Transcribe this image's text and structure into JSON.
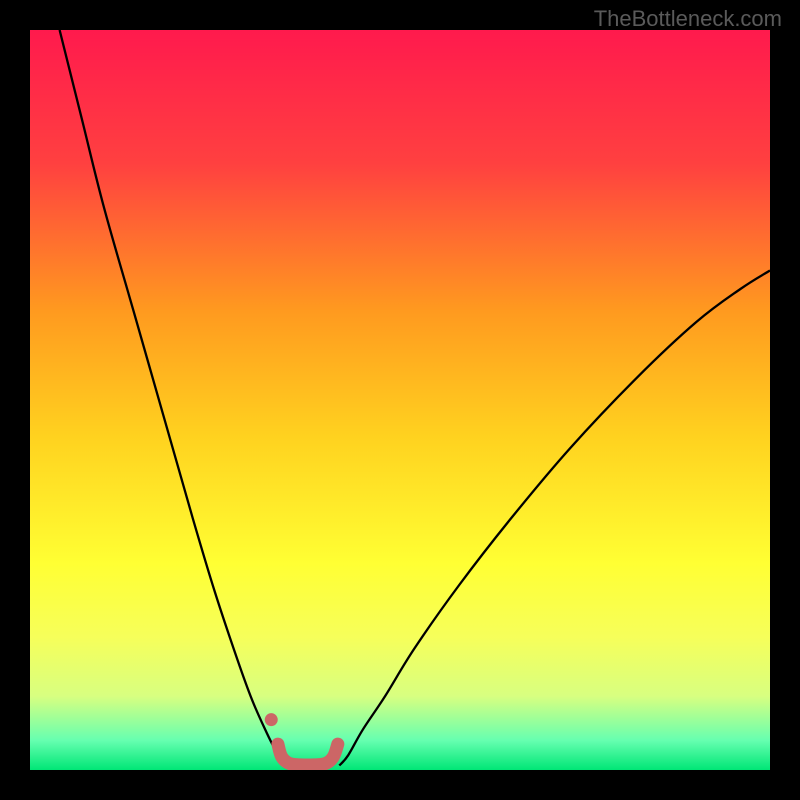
{
  "watermark": "TheBottleneck.com",
  "chart_data": {
    "type": "line",
    "title": "",
    "xlabel": "",
    "ylabel": "",
    "xlim": [
      0,
      100
    ],
    "ylim": [
      0,
      100
    ],
    "grid": false,
    "legend": false,
    "background_gradient": {
      "stops": [
        {
          "offset": 0.0,
          "color": "#ff1a4d"
        },
        {
          "offset": 0.18,
          "color": "#ff4040"
        },
        {
          "offset": 0.38,
          "color": "#ff9a1f"
        },
        {
          "offset": 0.55,
          "color": "#ffd21f"
        },
        {
          "offset": 0.72,
          "color": "#ffff33"
        },
        {
          "offset": 0.82,
          "color": "#f6ff5a"
        },
        {
          "offset": 0.9,
          "color": "#d8ff80"
        },
        {
          "offset": 0.96,
          "color": "#66ffb0"
        },
        {
          "offset": 1.0,
          "color": "#00e676"
        }
      ]
    },
    "series": [
      {
        "name": "curve-left",
        "stroke": "#000000",
        "stroke_width": 2.3,
        "x": [
          4.0,
          7.0,
          10.0,
          14.0,
          18.0,
          22.0,
          25.0,
          28.0,
          30.0,
          32.0,
          33.5,
          34.2
        ],
        "y": [
          100.0,
          88.0,
          76.0,
          62.0,
          48.0,
          34.0,
          24.0,
          15.0,
          9.5,
          5.0,
          2.0,
          0.6
        ]
      },
      {
        "name": "curve-right",
        "stroke": "#000000",
        "stroke_width": 2.3,
        "x": [
          41.8,
          43.0,
          45.0,
          48.0,
          52.0,
          58.0,
          65.0,
          73.0,
          82.0,
          90.0,
          96.0,
          100.0
        ],
        "y": [
          0.6,
          2.0,
          5.5,
          10.0,
          16.5,
          25.0,
          34.0,
          43.5,
          53.0,
          60.5,
          65.0,
          67.5
        ]
      },
      {
        "name": "highlight-band",
        "stroke": "#cc6666",
        "stroke_width": 13,
        "linecap": "round",
        "x": [
          33.5,
          34.0,
          35.0,
          36.5,
          38.5,
          40.0,
          41.0,
          41.6
        ],
        "y": [
          3.5,
          1.8,
          0.9,
          0.7,
          0.7,
          0.9,
          1.8,
          3.5
        ]
      },
      {
        "name": "highlight-dot",
        "type": "scatter",
        "color": "#cc6666",
        "radius": 6.5,
        "x": [
          32.6
        ],
        "y": [
          6.8
        ]
      }
    ]
  }
}
